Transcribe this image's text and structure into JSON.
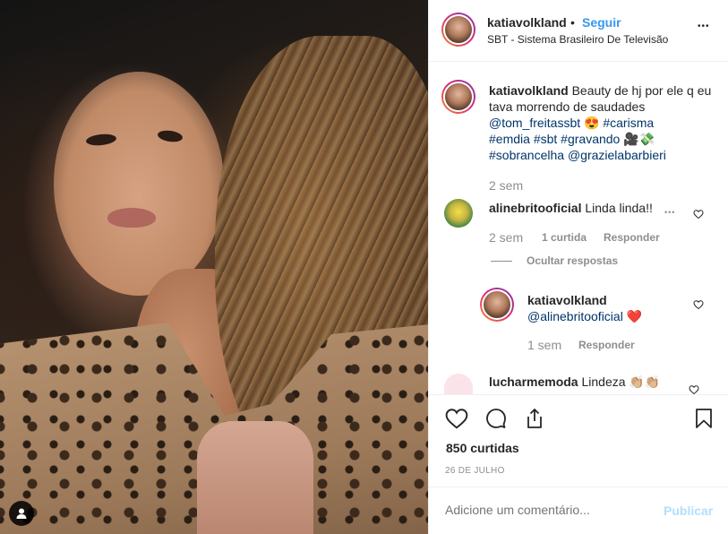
{
  "post": {
    "username": "katiavolkland",
    "dot": "•",
    "follow_label": "Seguir",
    "location": "SBT - Sistema Brasileiro De Televisão",
    "more_label": "•••"
  },
  "caption": {
    "username": "katiavolkland",
    "text": "Beauty de hj por ele q eu tava morrendo de saudades",
    "mention_1": "@tom_freitassbt",
    "emoji_1": "😍",
    "hashtags": [
      "#carisma",
      "#emdia",
      "#sbt",
      "#gravando"
    ],
    "emoji_2": "🎥💸",
    "hashtags_2": [
      "#sobrancelha"
    ],
    "mention_2": "@grazielabarbieri",
    "time": "2 sem"
  },
  "comments": [
    {
      "username": "alinebritooficial",
      "text": "Linda linda!!",
      "time": "2 sem",
      "likes": "1 curtida",
      "reply_label": "Responder",
      "hide_replies_label": "Ocultar respostas",
      "more_label": "•••"
    },
    {
      "username": "katiavolkland",
      "mention": "@alinebritooficial",
      "emoji": "❤️",
      "time": "1 sem",
      "reply_label": "Responder"
    },
    {
      "username": "lucharmemoda",
      "text": "Lindeza",
      "emoji": "👏🏼👏🏼"
    }
  ],
  "actions": {
    "likes": "850 curtidas",
    "date": "26 DE JULHO"
  },
  "composer": {
    "placeholder": "Adicione um comentário...",
    "publish_label": "Publicar"
  },
  "colors": {
    "link": "#003569",
    "follow": "#3897f0",
    "muted": "#8e8e8e",
    "publish_disabled": "#b2dffc",
    "like_heart": "#ed4956"
  }
}
